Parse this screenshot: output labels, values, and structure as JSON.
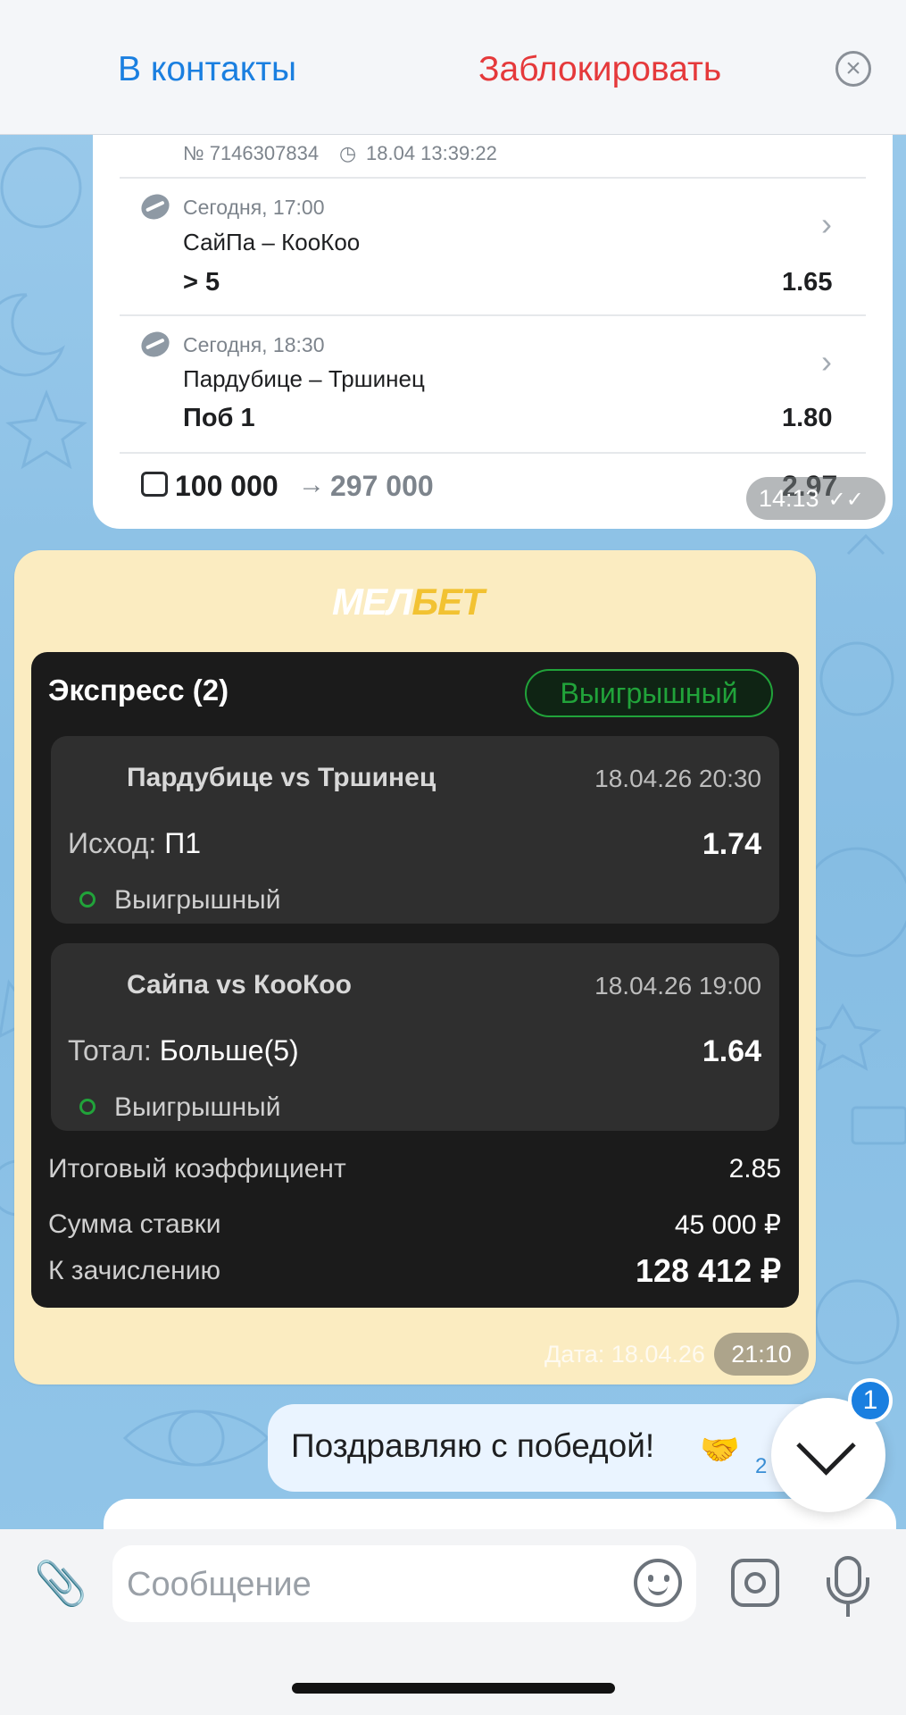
{
  "header": {
    "add_contact": "В контакты",
    "block": "Заблокировать",
    "close_icon": "close-circle-icon"
  },
  "coupon": {
    "number": "№ 7146307834",
    "timestamp": "18.04 13:39:22",
    "events": [
      {
        "when": "Сегодня, 17:00",
        "teams": "СайПа – КооКоо",
        "bet": "> 5",
        "odds": "1.65"
      },
      {
        "when": "Сегодня, 18:30",
        "teams": "Пардубице – Тршинец",
        "bet": "Поб 1",
        "odds": "1.80"
      }
    ],
    "stake": "100 000",
    "win": "297 000",
    "total_odds": "2.97",
    "time": "14:13"
  },
  "melbet": {
    "brand_left": "МЕЛ",
    "brand_right": "БЕТ",
    "title": "Экспресс (2)",
    "status": "Выигрышный",
    "events": [
      {
        "name": "Пардубице vs Тршинец",
        "date": "18.04.26  20:30",
        "label": "Исход:",
        "value": "П1",
        "odds": "1.74",
        "status": "Выигрышный"
      },
      {
        "name": "Сайпа vs КооКоо",
        "date": "18.04.26  19:00",
        "label": "Тотал:",
        "value": "Больше(5)",
        "odds": "1.64",
        "status": "Выигрышный"
      }
    ],
    "summary": [
      {
        "label": "Итоговый коэффициент",
        "value": "2.85"
      },
      {
        "label": "Сумма ставки",
        "value": "45 000 ₽"
      },
      {
        "label": "К зачислению",
        "value": "128 412 ₽"
      }
    ],
    "date_faded": "Дата: 18.04.26",
    "time": "21:10"
  },
  "outgoing": {
    "text": "Поздравляю с победой!",
    "emoji": "🤝",
    "time_fragment": "2"
  },
  "scroll": {
    "badge": "1"
  },
  "composer": {
    "placeholder": "Сообщение"
  },
  "colors": {
    "accent_blue": "#1a7fe0",
    "danger_red": "#e5393b",
    "win_green": "#21a33a",
    "melbet_yellow": "#f2c232",
    "card_dark": "#1b1b1b"
  }
}
